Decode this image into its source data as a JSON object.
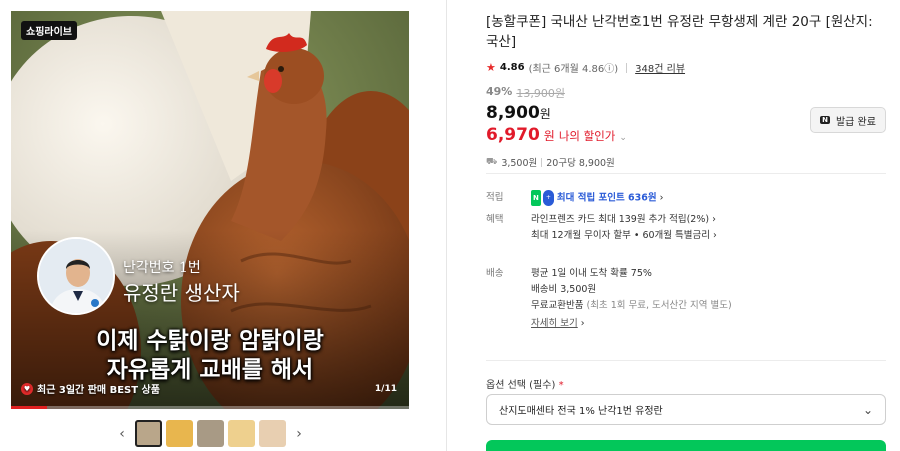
{
  "media": {
    "live_badge": "쇼핑라이브",
    "caption_small": "난각번호 1번",
    "caption_name": "유정란 생산자",
    "subtitle_line1": "이제 수탉이랑 암탉이랑",
    "subtitle_line2": "자유롭게 교배를 해서",
    "best_badge": "최근 3일간 판매 BEST 상품",
    "counter": "1/11",
    "progress_fraction": 0.09
  },
  "thumbnails": {
    "prev": "‹",
    "next": "›",
    "colors": [
      "#b9a68a",
      "#e8b64e",
      "#a89a85",
      "#eed08e",
      "#e8cfb1"
    ]
  },
  "product": {
    "title": "[농할쿠폰] 국내산 난각번호1번 유정란 무항생제 계란 20구 [원산지: 국산]",
    "rating_star": "★",
    "rating": "4.86",
    "recent_rating": "(최근 6개월 4.86ⓘ)",
    "review_count": "348건 리뷰",
    "discount_pct": "49%",
    "original_price": "13,900원",
    "price": "8,900",
    "price_unit": "원",
    "my_price": "6,970",
    "my_price_unit": "원",
    "my_price_label": "나의 할인가",
    "coupon_button": "발급 완료",
    "shipping_fee_short": "3,500원",
    "unit_price": "20구당 8,900원"
  },
  "benefits": {
    "points_label": "적립",
    "points_text": "최대 적립 포인트 636원",
    "perks_label": "혜택",
    "perk1": "라인프렌즈 카드 최대 139원 추가 적립(2%)",
    "perk2": "최대 12개월 무이자 할부 • 60개월 특별금리",
    "shipping_label": "배송",
    "ship1": "평균 1일 이내 도착 확률 75%",
    "ship2": "배송비 3,500원",
    "ship3_main": "무료교환반품",
    "ship3_sub": "(최초 1회 무료, 도서산간 지역 별도)",
    "detail_link": "자세히 보기"
  },
  "option": {
    "label": "옵션 선택 (필수)",
    "required_mark": "*",
    "selected": "산지도매센타 전국 1% 난각1번 유정란"
  },
  "colors": {
    "accent_red": "#e11a2a",
    "naver_green": "#03c75a",
    "link_blue": "#2a5bd7"
  }
}
